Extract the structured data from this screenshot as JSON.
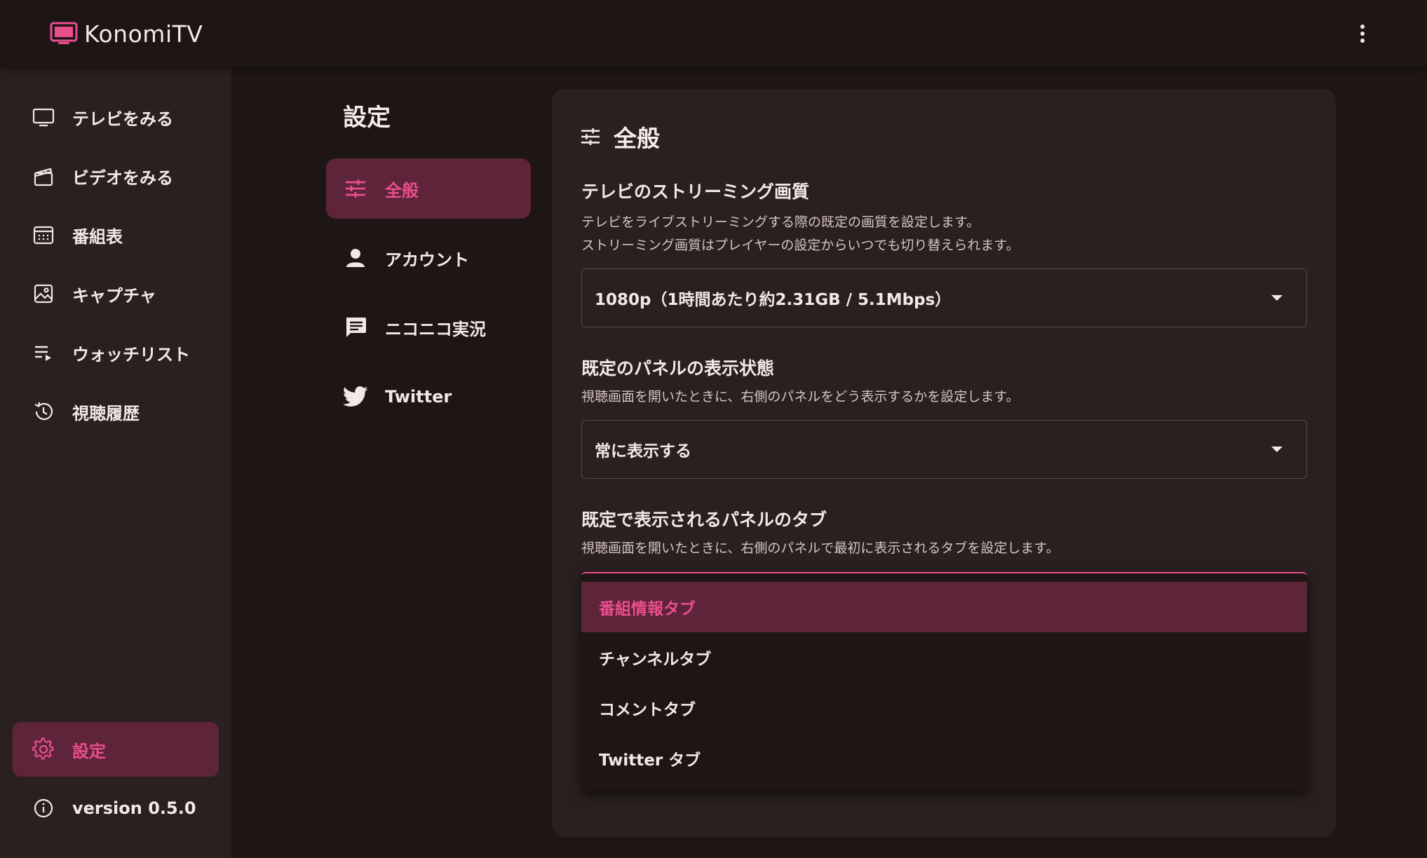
{
  "app": {
    "title": "KonomiTV",
    "logo_icon": "tv-icon",
    "menu_icon": "more-vertical-icon"
  },
  "colors": {
    "accent": "#e94e8d",
    "active_bg": "#5e2439",
    "background": "#1e1515",
    "surface": "#2b2020"
  },
  "nav": {
    "items": [
      {
        "label": "テレビをみる",
        "icon": "tv-icon"
      },
      {
        "label": "ビデオをみる",
        "icon": "video-clapperboard-icon"
      },
      {
        "label": "番組表",
        "icon": "calendar-grid-icon"
      },
      {
        "label": "キャプチャ",
        "icon": "image-icon"
      },
      {
        "label": "ウォッチリスト",
        "icon": "playlist-icon"
      },
      {
        "label": "視聴履歴",
        "icon": "history-icon"
      }
    ],
    "settings": {
      "label": "設定",
      "icon": "gear-icon",
      "active": true
    },
    "version": {
      "label": "version 0.5.0",
      "icon": "info-icon"
    }
  },
  "settings_nav": {
    "title": "設定",
    "items": [
      {
        "label": "全般",
        "icon": "sliders-icon",
        "active": true
      },
      {
        "label": "アカウント",
        "icon": "user-icon"
      },
      {
        "label": "ニコニコ実況",
        "icon": "comment-icon"
      },
      {
        "label": "Twitter",
        "icon": "twitter-icon"
      }
    ]
  },
  "general": {
    "title": "全般",
    "title_icon": "sliders-icon",
    "sections": [
      {
        "title": "テレビのストリーミング画質",
        "description": [
          "テレビをライブストリーミングする際の既定の画質を設定します。",
          "ストリーミング画質はプレイヤーの設定からいつでも切り替えられます。"
        ],
        "value": "1080p（1時間あたり約2.31GB / 5.1Mbps）"
      },
      {
        "title": "既定のパネルの表示状態",
        "description": [
          "視聴画面を開いたときに、右側のパネルをどう表示するかを設定します。"
        ],
        "value": "常に表示する"
      },
      {
        "title": "既定で表示されるパネルのタブ",
        "description": [
          "視聴画面を開いたときに、右側のパネルで最初に表示されるタブを設定します。"
        ],
        "options": [
          "番組情報タブ",
          "チャンネルタブ",
          "コメントタブ",
          "Twitter タブ"
        ],
        "selected": "番組情報タブ"
      }
    ]
  }
}
